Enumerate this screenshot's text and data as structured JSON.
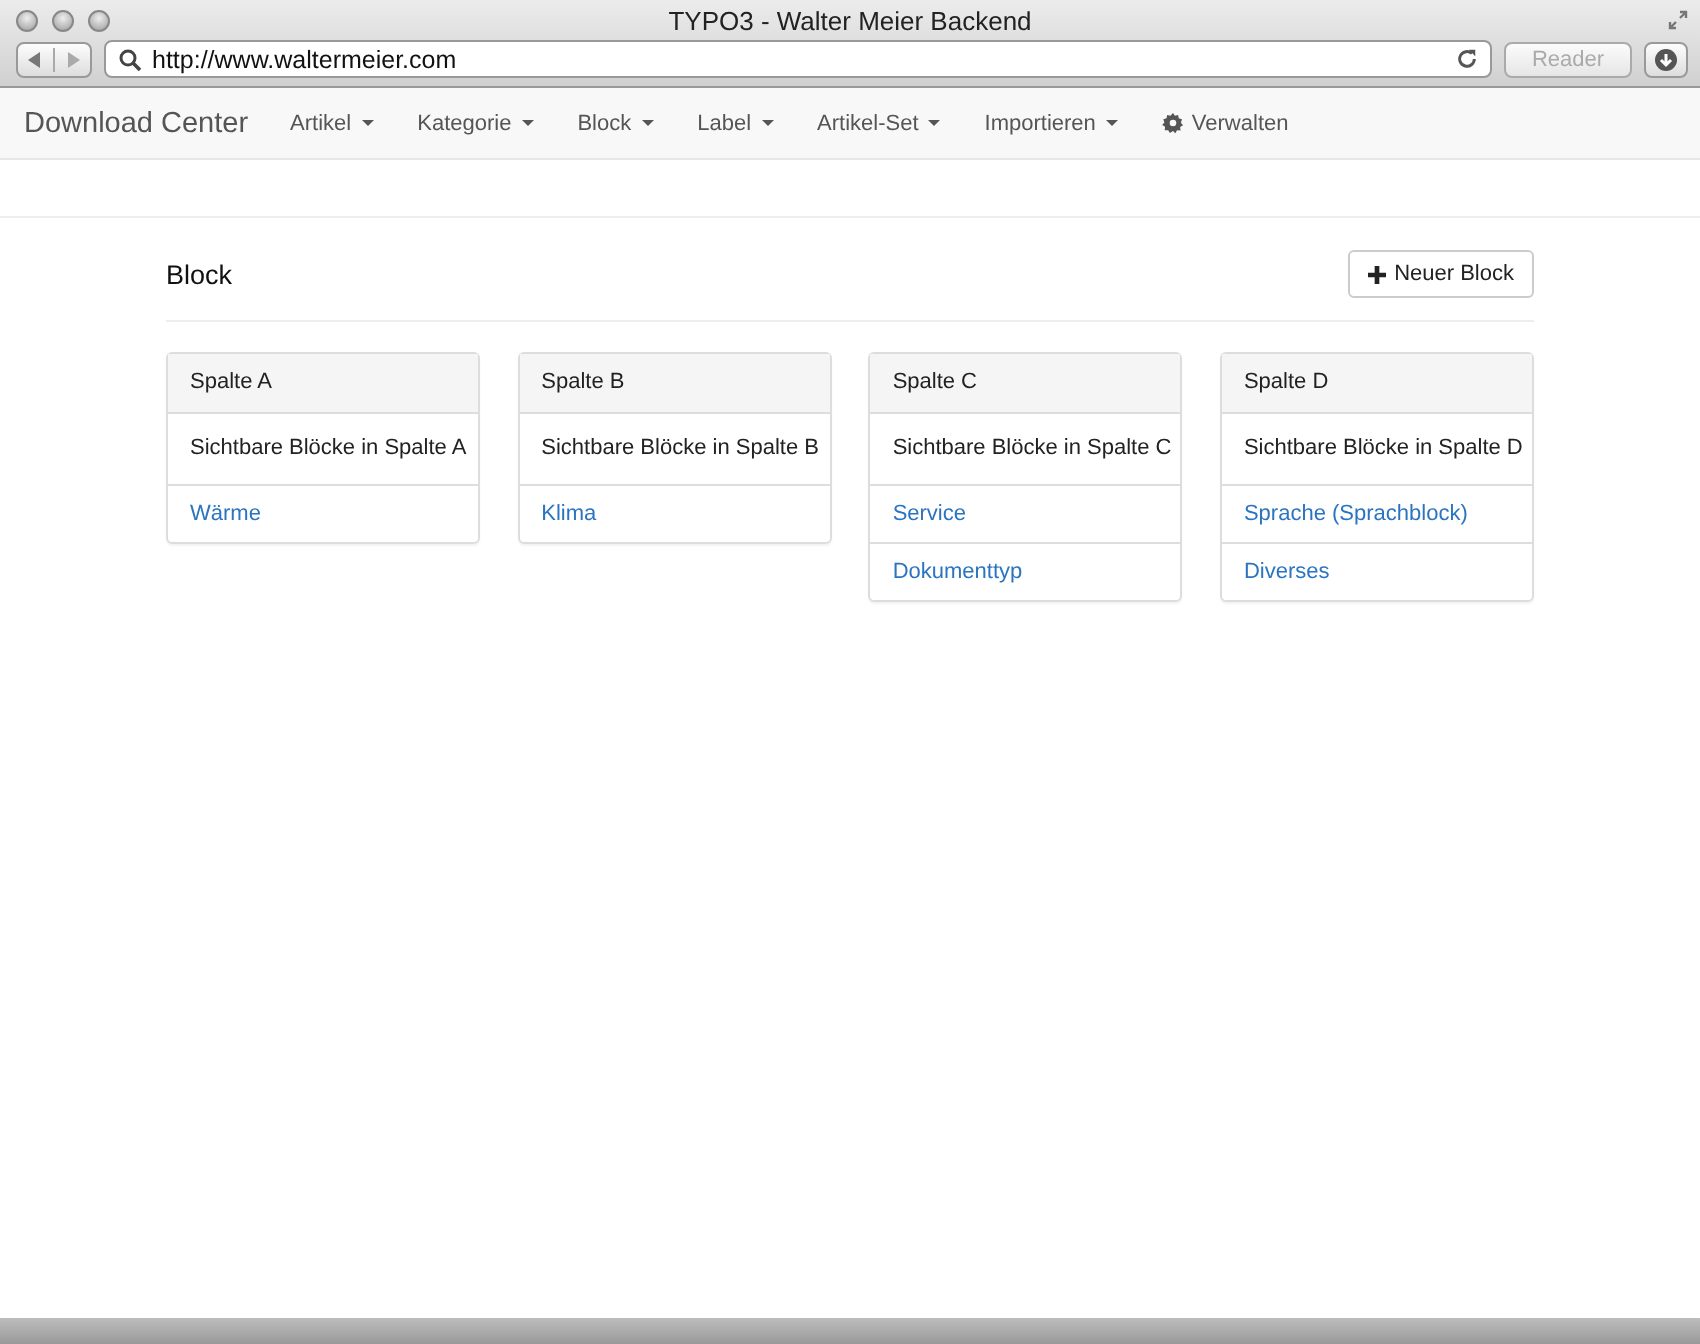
{
  "window": {
    "title": "TYPO3 - Walter Meier Backend"
  },
  "toolbar": {
    "url": "http://www.waltermeier.com",
    "reader_button": "Reader"
  },
  "navbar": {
    "brand": "Download Center",
    "items": [
      {
        "label": "Artikel",
        "kind": "dropdown"
      },
      {
        "label": "Kategorie",
        "kind": "dropdown"
      },
      {
        "label": "Block",
        "kind": "dropdown"
      },
      {
        "label": "Label",
        "kind": "dropdown"
      },
      {
        "label": "Artikel-Set",
        "kind": "dropdown"
      },
      {
        "label": "Importieren",
        "kind": "dropdown"
      },
      {
        "label": "Verwalten",
        "kind": "settings"
      }
    ]
  },
  "page": {
    "heading": "Block",
    "new_button": "Neuer Block"
  },
  "columns": [
    {
      "title": "Spalte A",
      "subtitle": "Sichtbare Blöcke in Spalte A",
      "links": [
        "Wärme"
      ]
    },
    {
      "title": "Spalte B",
      "subtitle": "Sichtbare Blöcke in Spalte B",
      "links": [
        "Klima"
      ]
    },
    {
      "title": "Spalte C",
      "subtitle": "Sichtbare Blöcke in Spalte C",
      "links": [
        "Service",
        "Dokumenttyp"
      ]
    },
    {
      "title": "Spalte D",
      "subtitle": "Sichtbare Blöcke in Spalte D",
      "links": [
        "Sprache (Sprachblock)",
        "Diverses"
      ]
    }
  ]
}
